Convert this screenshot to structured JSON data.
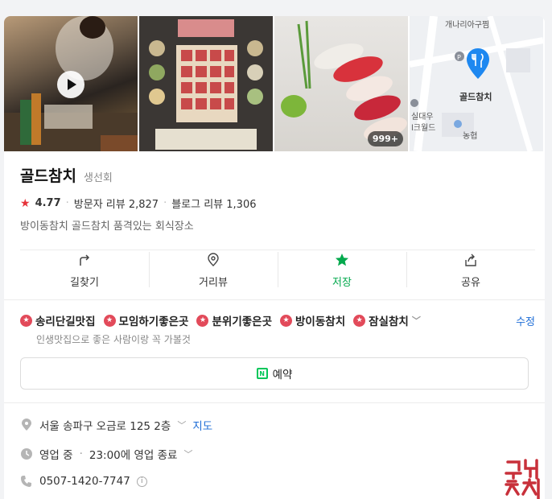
{
  "gallery": {
    "photo_count": "999+",
    "map": {
      "labels": [
        "개나리아구찜",
        "실대우",
        "l크월드",
        "농협"
      ],
      "pin_label": "골드참치"
    }
  },
  "place": {
    "name": "골드참치",
    "category": "생선회",
    "rating": "4.77",
    "visitor_reviews": "방문자 리뷰 2,827",
    "blog_reviews": "블로그 리뷰 1,306",
    "description": "방이동참치 골드참치 품격있는 회식장소"
  },
  "actions": [
    {
      "label": "길찾기"
    },
    {
      "label": "거리뷰"
    },
    {
      "label": "저장"
    },
    {
      "label": "공유"
    }
  ],
  "tags": {
    "items": [
      "송리단길맛집",
      "모임하기좋은곳",
      "분위기좋은곳",
      "방이동참치",
      "잠실참치"
    ],
    "edit_label": "수정",
    "description": "인생맛집으로 좋은 사람이랑 꼭 가볼것"
  },
  "reserve": {
    "label": "예약"
  },
  "details": {
    "address": "서울 송파구 오금로 125 2층",
    "map_link": "지도",
    "status": "영업 중",
    "hours": "23:00에 영업 종료",
    "phone": "0507-1420-7747"
  },
  "colors": {
    "accent_green": "#03a94d",
    "star_red": "#e6333a",
    "link_blue": "#1e6dd6",
    "tag_red": "#e24a5a"
  }
}
